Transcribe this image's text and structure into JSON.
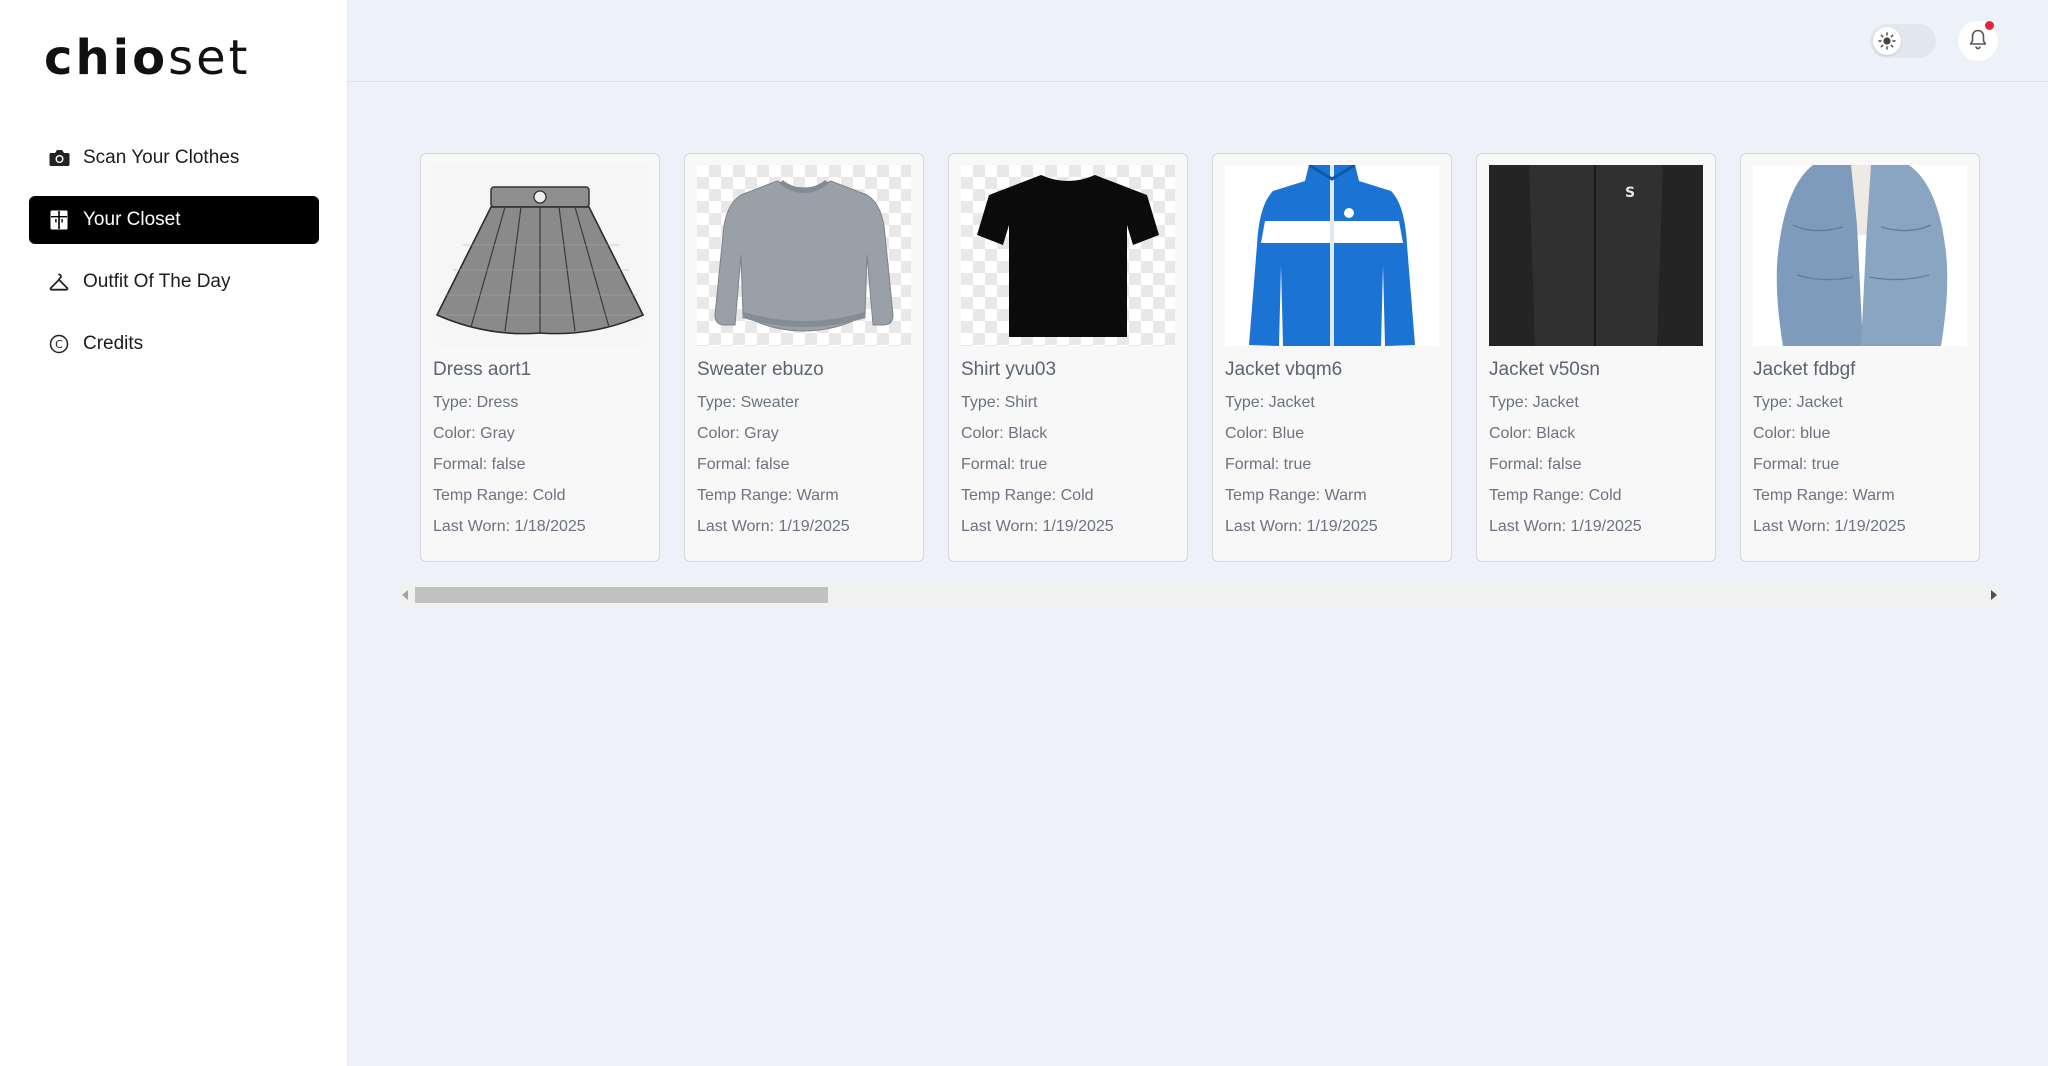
{
  "app": {
    "logo_bold": "chio",
    "logo_light": "set"
  },
  "sidebar": {
    "items": [
      {
        "label": "Scan Your Clothes",
        "icon": "camera-icon",
        "active": false
      },
      {
        "label": "Your Closet",
        "icon": "closet-icon",
        "active": true
      },
      {
        "label": "Outfit Of The Day",
        "icon": "hanger-icon",
        "active": false
      },
      {
        "label": "Credits",
        "icon": "copyright-icon",
        "active": false
      }
    ]
  },
  "header": {
    "theme_toggle_icon": "sun-icon",
    "notification_icon": "bell-icon",
    "notification_dot_color": "#e3263b"
  },
  "closet": {
    "items": [
      {
        "name": "Dress aort1",
        "type": "Type: Dress",
        "color": "Color: Gray",
        "formal": "Formal: false",
        "temp": "Temp Range: Cold",
        "last_worn": "Last Worn: 1/18/2025",
        "image": "gray-pleated-skirt"
      },
      {
        "name": "Sweater ebuzo",
        "type": "Type: Sweater",
        "color": "Color: Gray",
        "formal": "Formal: false",
        "temp": "Temp Range: Warm",
        "last_worn": "Last Worn: 1/19/2025",
        "image": "gray-sweater"
      },
      {
        "name": "Shirt yvu03",
        "type": "Type: Shirt",
        "color": "Color: Black",
        "formal": "Formal: true",
        "temp": "Temp Range: Cold",
        "last_worn": "Last Worn: 1/19/2025",
        "image": "black-tshirt"
      },
      {
        "name": "Jacket vbqm6",
        "type": "Type: Jacket",
        "color": "Color: Blue",
        "formal": "Formal: true",
        "temp": "Temp Range: Warm",
        "last_worn": "Last Worn: 1/19/2025",
        "image": "blue-track-jacket"
      },
      {
        "name": "Jacket v50sn",
        "type": "Type: Jacket",
        "color": "Color: Black",
        "formal": "Formal: false",
        "temp": "Temp Range: Cold",
        "last_worn": "Last Worn: 1/19/2025",
        "image": "black-jacket"
      },
      {
        "name": "Jacket fdbgf",
        "type": "Type: Jacket",
        "color": "Color: blue",
        "formal": "Formal: true",
        "temp": "Temp Range: Warm",
        "last_worn": "Last Worn: 1/19/2025",
        "image": "denim-jacket"
      }
    ]
  },
  "colors": {
    "active_nav_bg": "#000000",
    "page_bg": "#eef1f7"
  }
}
